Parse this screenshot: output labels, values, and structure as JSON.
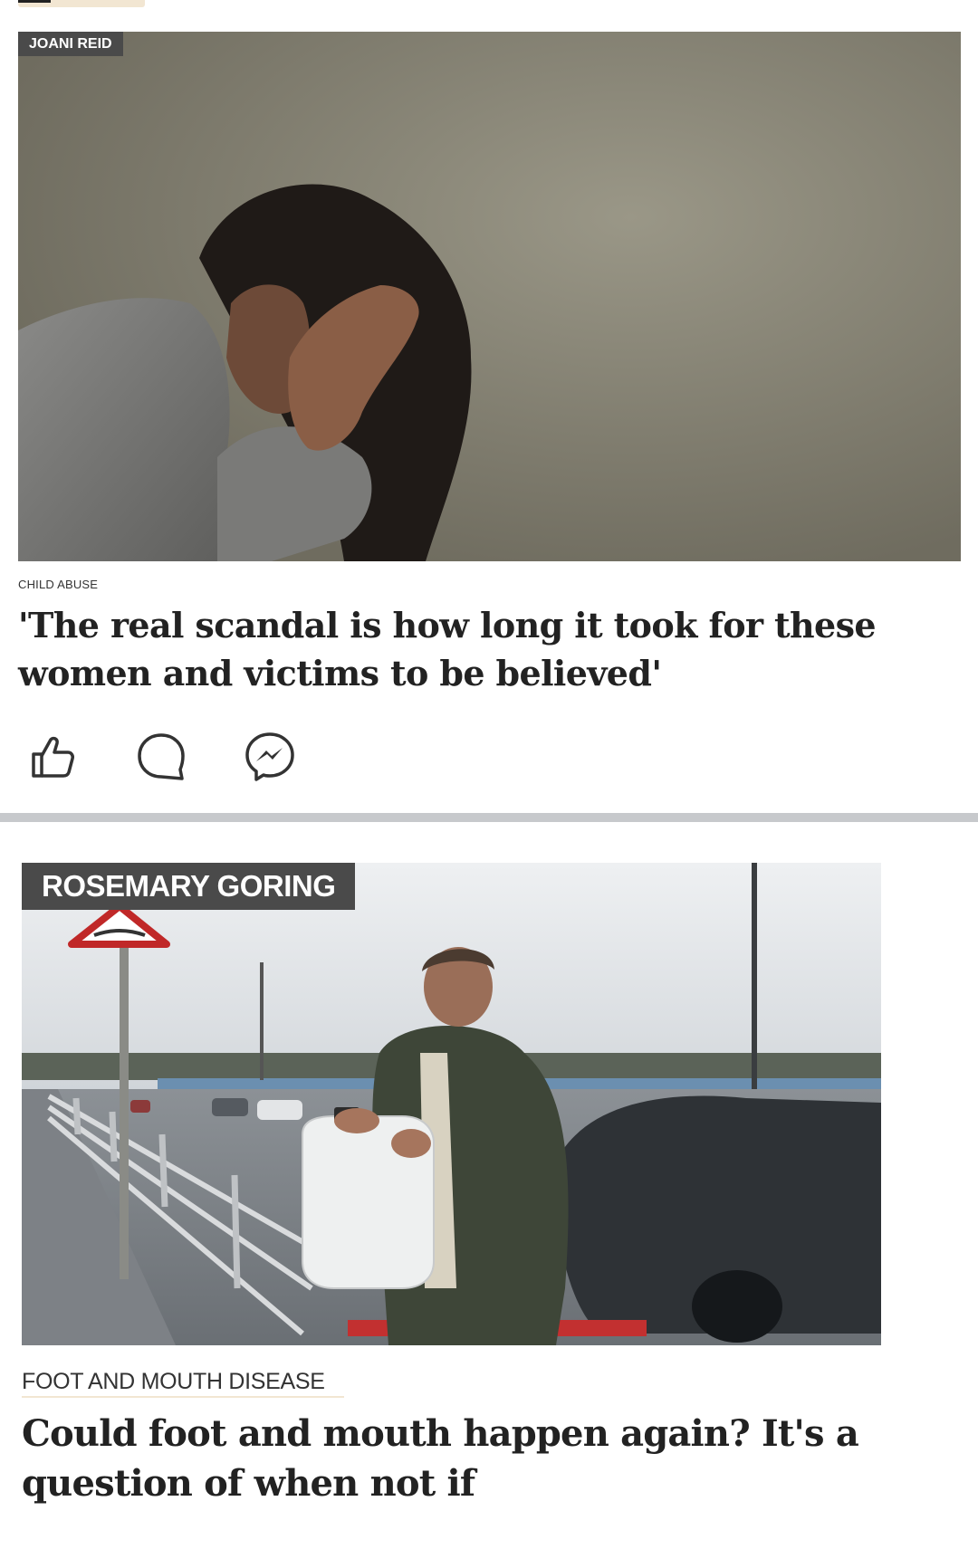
{
  "articles": [
    {
      "author": "JOANI REID",
      "category": "CHILD ABUSE",
      "headline": "'The real scandal is how long it took for these women and victims to be believed'",
      "image": "woman-holding-head-photo",
      "actions": [
        "like-icon",
        "comment-icon",
        "messenger-icon"
      ]
    },
    {
      "author": "ROSEMARY GORING",
      "category": "FOOT AND MOUTH DISEASE",
      "headline": "Could foot and mouth happen again? It's a question of when not if",
      "image": "man-with-water-container-on-bridge-photo"
    }
  ],
  "colors": {
    "badge_bg": "#4a4a4a",
    "divider": "#c7c9cc",
    "accent_underline": "#f2e6d2",
    "headline_text": "#222222"
  }
}
